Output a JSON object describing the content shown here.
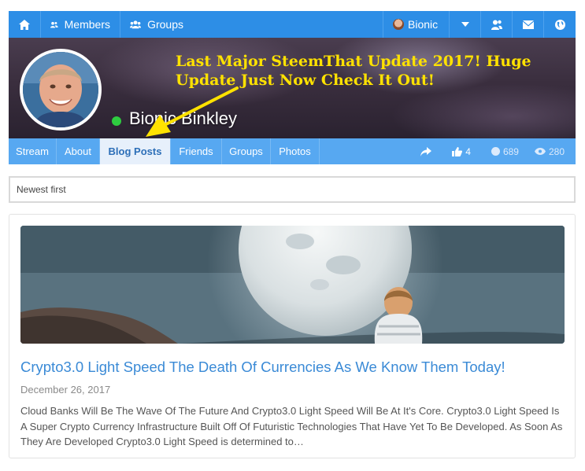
{
  "topnav": {
    "members_label": "Members",
    "groups_label": "Groups",
    "user_label": "Bionic"
  },
  "cover": {
    "headline": "Last Major SteemThat Update 2017! Huge Update Just Now Check It Out!",
    "profile_name": "Bionic Binkley"
  },
  "subnav": {
    "tabs": [
      {
        "label": "Stream"
      },
      {
        "label": "About"
      },
      {
        "label": "Blog Posts",
        "active": true
      },
      {
        "label": "Friends"
      },
      {
        "label": "Groups"
      },
      {
        "label": "Photos"
      }
    ],
    "likes": "4",
    "points": "689",
    "views": "280"
  },
  "sort": {
    "selected": "Newest first"
  },
  "post": {
    "title": "Crypto3.0 Light Speed The Death Of Currencies As We Know Them Today!",
    "date": "December 26, 2017",
    "excerpt": "Cloud Banks Will Be The Wave Of The Future And Crypto3.0 Light Speed Will Be At It's Core. Crypto3.0 Light Speed Is A Super Crypto Currency Infrastructure Built Off Of Futuristic Technologies That Have Yet To Be Developed. As Soon As They Are Developed Crypto3.0 Light Speed is determined to…"
  },
  "colors": {
    "nav_blue": "#2d8ee6",
    "subnav_blue": "#57a8f1",
    "headline_yellow": "#ffe200",
    "link_blue": "#3a8ad6",
    "online_green": "#2ecc40"
  },
  "icons": [
    "home-icon",
    "users-icon",
    "group-icon",
    "chevron-down-icon",
    "friends-icon",
    "envelope-icon",
    "globe-icon",
    "share-icon",
    "thumbs-up-icon",
    "circle-icon",
    "eye-icon"
  ]
}
